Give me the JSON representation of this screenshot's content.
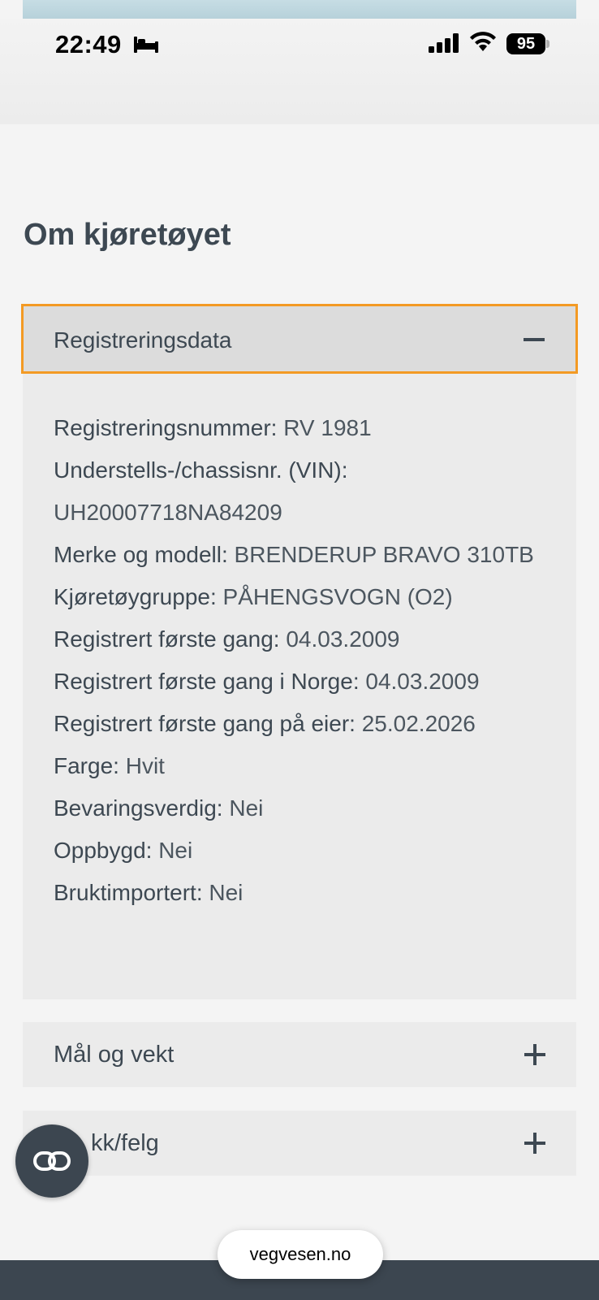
{
  "status_bar": {
    "time": "22:49",
    "battery": "95",
    "icons": [
      "bed-icon",
      "signal-icon",
      "wifi-icon",
      "battery-icon"
    ]
  },
  "page_title": "Om kjøretøyet",
  "accordion": {
    "open_section": {
      "label": "Registreringsdata",
      "toggle_icon": "minus-icon",
      "rows": [
        {
          "key": "Registreringsnummer:",
          "value": "RV 1981"
        },
        {
          "key": "Understells-/chassisnr. (VIN):",
          "value": ""
        },
        {
          "key": "",
          "value": "UH20007718NA84209"
        },
        {
          "key": "Merke og modell:",
          "value": "BRENDERUP BRAVO 310TB"
        },
        {
          "key": "Kjøretøygruppe:",
          "value": "PÅHENGSVOGN (O2)"
        },
        {
          "key": "Registrert første gang:",
          "value": "04.03.2009"
        },
        {
          "key": "Registrert første gang i Norge:",
          "value": "04.03.2009"
        },
        {
          "key": "Registrert første gang på eier:",
          "value": "25.02.2026"
        },
        {
          "key": "Farge:",
          "value": "Hvit"
        },
        {
          "key": "Bevaringsverdig:",
          "value": "Nei"
        },
        {
          "key": "Oppbygd:",
          "value": "Nei"
        },
        {
          "key": "Bruktimportert:",
          "value": "Nei"
        }
      ]
    },
    "collapsed_sections": [
      {
        "label": "Mål og vekt",
        "toggle_icon": "plus-icon"
      },
      {
        "label": "kk/felg",
        "toggle_icon": "plus-icon"
      }
    ]
  },
  "fab": {
    "icon": "chat-icon"
  },
  "browser": {
    "url": "vegvesen.no"
  },
  "colors": {
    "accent_focus": "#f39a24",
    "text": "#3d4852",
    "dark_bar": "#3c4650"
  }
}
